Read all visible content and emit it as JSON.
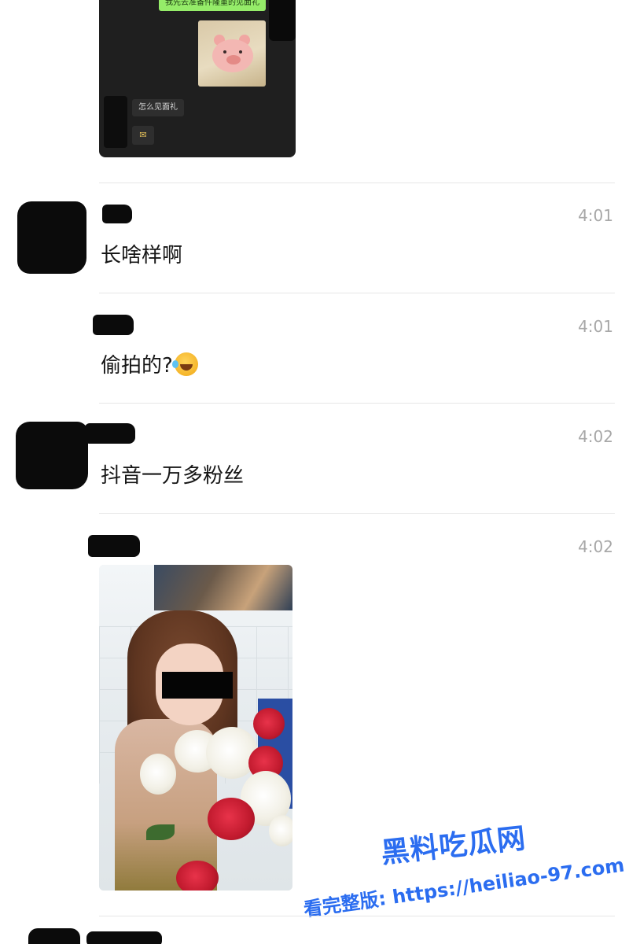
{
  "embedded_screenshot": {
    "green_bubble_text": "我先去准备件隆重的见面礼",
    "dark_bubble_text": "怎么见面礼",
    "small_bubble_icon": "envelope-icon"
  },
  "messages": [
    {
      "time": "4:01",
      "text": "长啥样啊"
    },
    {
      "time": "4:01",
      "text": "偷拍的?",
      "emoji": "laughing-tears-emoji"
    },
    {
      "time": "4:02",
      "text": "抖音一万多粉丝"
    },
    {
      "time": "4:02",
      "type": "image"
    }
  ],
  "watermark": {
    "title": "黑料吃瓜网",
    "prefix": "看完整版:",
    "url": "https://heiliao-97.com"
  },
  "colors": {
    "background": "#ffffff",
    "time_text": "#a8a8a8",
    "wechat_green": "#95ec69",
    "watermark_blue": "#2b6df0"
  }
}
